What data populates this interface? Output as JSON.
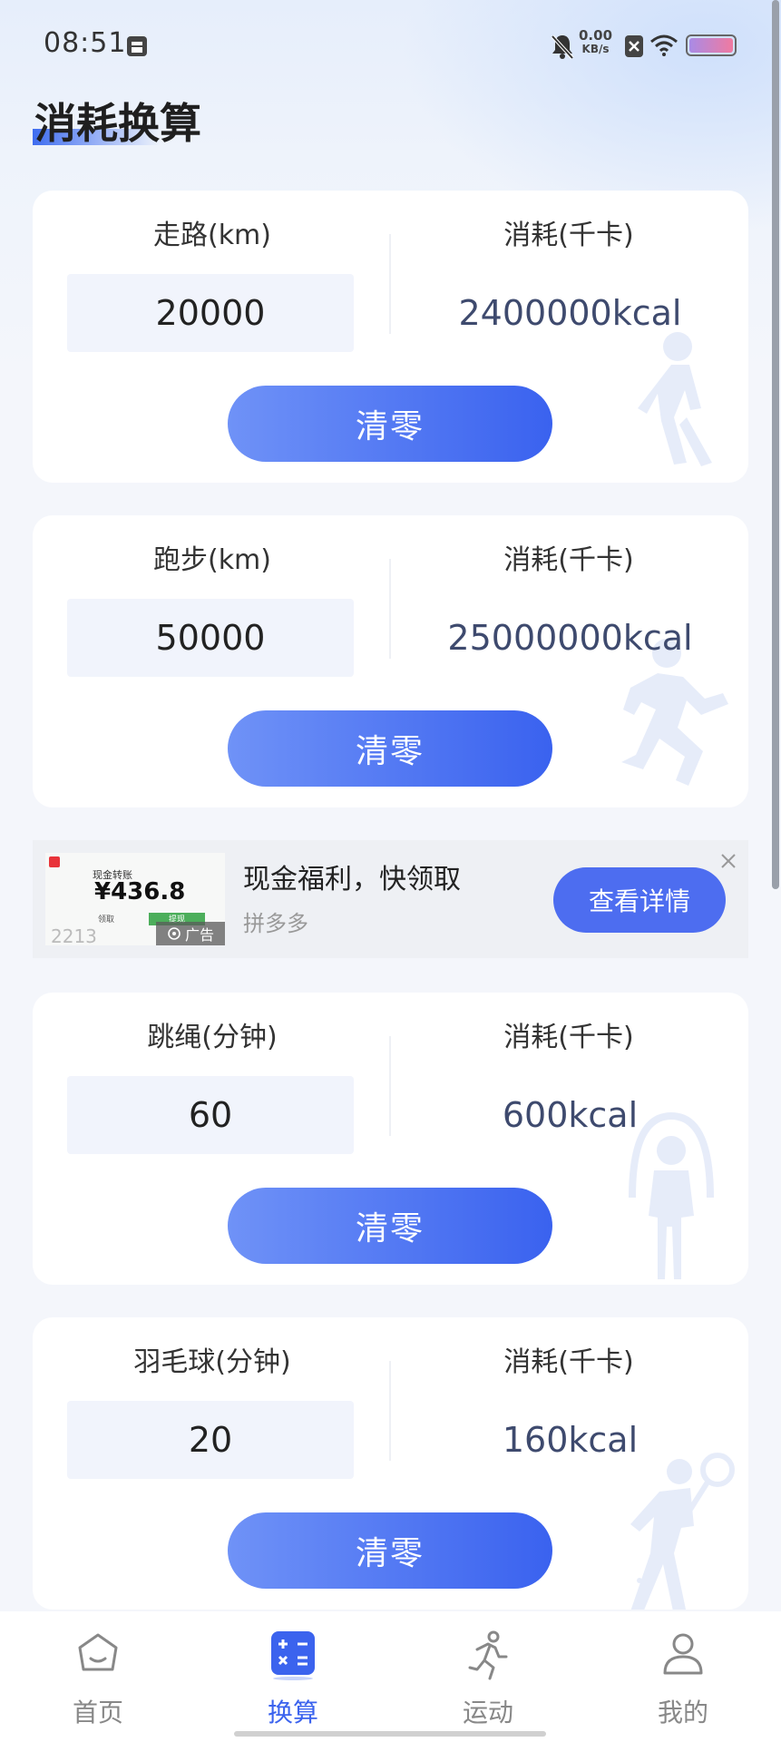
{
  "status_bar": {
    "time": "08:51",
    "net_speed_value": "0.00",
    "net_speed_unit": "KB/s"
  },
  "page": {
    "title": "消耗换算"
  },
  "cards": [
    {
      "activity_label": "走路(km)",
      "result_label": "消耗(千卡)",
      "input_value": "20000",
      "result_value": "2400000kcal",
      "clear_label": "清零",
      "figure": "walking-figure-icon"
    },
    {
      "activity_label": "跑步(km)",
      "result_label": "消耗(千卡)",
      "input_value": "50000",
      "result_value": "25000000kcal",
      "clear_label": "清零",
      "figure": "running-figure-icon"
    },
    {
      "activity_label": "跳绳(分钟)",
      "result_label": "消耗(千卡)",
      "input_value": "60",
      "result_value": "600kcal",
      "clear_label": "清零",
      "figure": "jump-rope-figure-icon"
    },
    {
      "activity_label": "羽毛球(分钟)",
      "result_label": "消耗(千卡)",
      "input_value": "20",
      "result_value": "160kcal",
      "clear_label": "清零",
      "figure": "badminton-figure-icon"
    }
  ],
  "ad": {
    "thumb_label": "现金转账",
    "thumb_price": "¥436.8",
    "thumb_btn_1": "领取",
    "thumb_btn_2": "提现",
    "thumb_digits": "2213",
    "ad_tag": "广告",
    "title": "现金福利，快领取",
    "brand": "拼多多",
    "button": "查看详情"
  },
  "nav": [
    {
      "label": "首页",
      "icon": "home-icon",
      "active": false
    },
    {
      "label": "换算",
      "icon": "calculator-icon",
      "active": true
    },
    {
      "label": "运动",
      "icon": "running-icon",
      "active": false
    },
    {
      "label": "我的",
      "icon": "profile-icon",
      "active": false
    }
  ],
  "colors": {
    "accent": "#3b63ee",
    "button_gradient_start": "#6f92f7",
    "button_gradient_end": "#3a62ef",
    "ad_button": "#4d6df0"
  }
}
